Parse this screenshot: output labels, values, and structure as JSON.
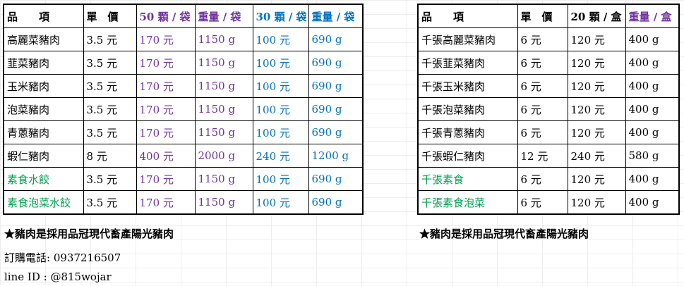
{
  "left_table": {
    "headers": [
      "品　　項",
      "單　價",
      "50 顆 / 袋",
      "重量 / 袋",
      "30 顆 / 袋",
      "重量 / 袋"
    ],
    "rows": [
      {
        "name": "高麗菜豬肉",
        "price": "3.5 元",
        "pack50": "170 元",
        "weight50": "1150 g",
        "pack30": "100 元",
        "weight30": "690 g",
        "green": false
      },
      {
        "name": "韮菜豬肉",
        "price": "3.5 元",
        "pack50": "170 元",
        "weight50": "1150 g",
        "pack30": "100 元",
        "weight30": "690 g",
        "green": false
      },
      {
        "name": "玉米豬肉",
        "price": "3.5 元",
        "pack50": "170 元",
        "weight50": "1150 g",
        "pack30": "100 元",
        "weight30": "690 g",
        "green": false
      },
      {
        "name": "泡菜豬肉",
        "price": "3.5 元",
        "pack50": "170 元",
        "weight50": "1150 g",
        "pack30": "100 元",
        "weight30": "690 g",
        "green": false
      },
      {
        "name": "青蔥豬肉",
        "price": "3.5 元",
        "pack50": "170 元",
        "weight50": "1150 g",
        "pack30": "100 元",
        "weight30": "690 g",
        "green": false
      },
      {
        "name": "蝦仁豬肉",
        "price": "8 元",
        "pack50": "400 元",
        "weight50": "2000 g",
        "pack30": "240 元",
        "weight30": "1200 g",
        "green": false
      },
      {
        "name": "素食水餃",
        "price": "3.5 元",
        "pack50": "170 元",
        "weight50": "1150 g",
        "pack30": "100 元",
        "weight30": "690 g",
        "green": true
      },
      {
        "name": "素食泡菜水餃",
        "price": "3.5 元",
        "pack50": "170 元",
        "weight50": "1150 g",
        "pack30": "100 元",
        "weight30": "690 g",
        "green": true
      }
    ]
  },
  "right_table": {
    "headers": [
      "品　　項",
      "單　價",
      "20 顆 / 盒",
      "重量 / 盒"
    ],
    "rows": [
      {
        "name": "千張高麗菜豬肉",
        "price": "6 元",
        "pack20": "120 元",
        "weight20": "400 g",
        "green": false
      },
      {
        "name": "千張韮菜豬肉",
        "price": "6 元",
        "pack20": "120 元",
        "weight20": "400 g",
        "green": false
      },
      {
        "name": "千張玉米豬肉",
        "price": "6 元",
        "pack20": "120 元",
        "weight20": "400 g",
        "green": false
      },
      {
        "name": "千張泡菜豬肉",
        "price": "6 元",
        "pack20": "120 元",
        "weight20": "400 g",
        "green": false
      },
      {
        "name": "千張青蔥豬肉",
        "price": "6 元",
        "pack20": "120 元",
        "weight20": "400 g",
        "green": false
      },
      {
        "name": "千張蝦仁豬肉",
        "price": "12 元",
        "pack20": "240 元",
        "weight20": "580 g",
        "green": false
      },
      {
        "name": "千張素食",
        "price": "6 元",
        "pack20": "120 元",
        "weight20": "400 g",
        "green": true
      },
      {
        "name": "千張素食泡菜",
        "price": "6 元",
        "pack20": "120 元",
        "weight20": "400 g",
        "green": true
      }
    ]
  },
  "notes": {
    "left_note": "★豬肉是採用品冠現代畜產陽光豬肉",
    "right_note": "★豬肉是採用品冠現代畜產陽光豬肉",
    "phone": "訂購電話: 0937216507",
    "line_id": "line ID : @815wojar"
  },
  "colors": {
    "purple": "#7030a0",
    "blue": "#0070c0",
    "green": "#00a050"
  }
}
